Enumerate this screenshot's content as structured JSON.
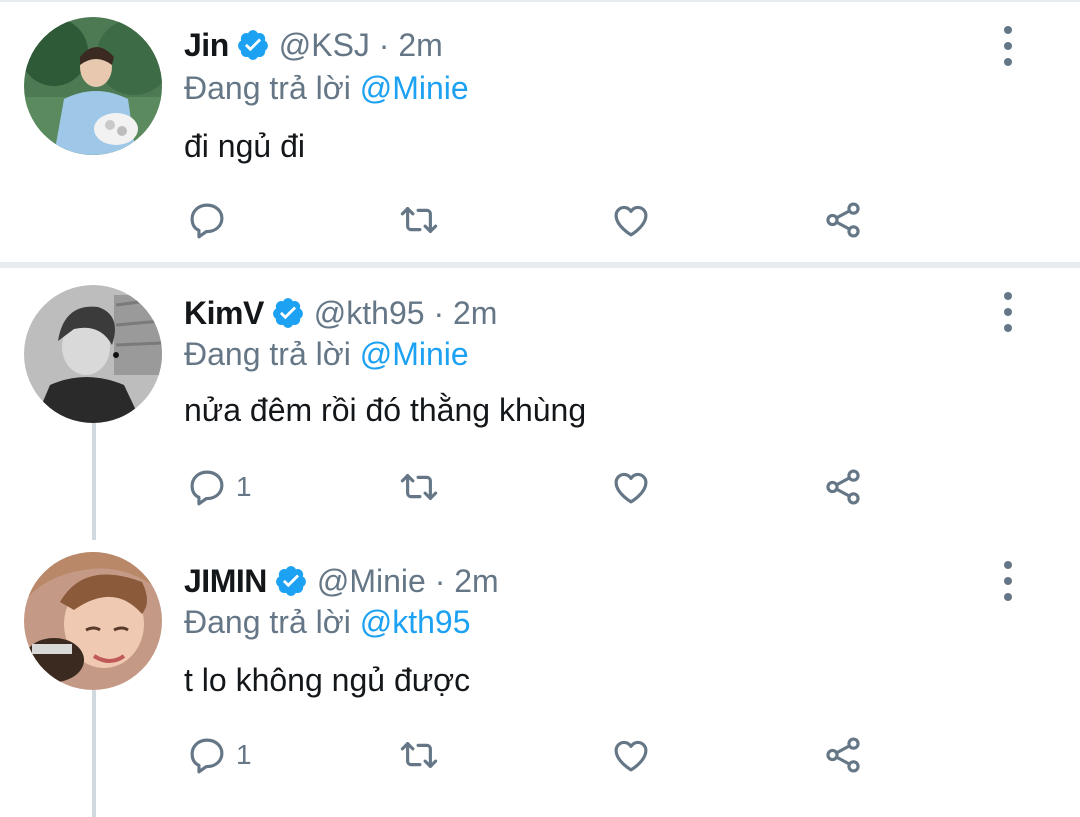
{
  "tweets": [
    {
      "name": "Jin",
      "handle": "@KSJ · 2m",
      "reply_prefix": "Đang trả lời",
      "reply_to": "@Minie",
      "text": "đi ngủ đi",
      "reply_count": ""
    },
    {
      "name": "KimV",
      "handle": "@kth95 · 2m",
      "reply_prefix": "Đang trả lời",
      "reply_to": "@Minie",
      "text": "nửa đêm rồi đó thằng khùng",
      "reply_count": "1"
    },
    {
      "name": "JIMIN",
      "handle": "@Minie · 2m",
      "reply_prefix": "Đang trả lời",
      "reply_to": "@kth95",
      "text": "t lo không ngủ được",
      "reply_count": "1"
    }
  ],
  "icons": {
    "verified": "verified-badge-icon",
    "reply": "reply-icon",
    "retweet": "retweet-icon",
    "like": "heart-icon",
    "share": "share-icon",
    "more": "more-vertical-icon"
  },
  "colors": {
    "accent": "#1da1f2",
    "secondary_text": "#657786",
    "primary_text": "#14171a",
    "divider": "#e6ecf0"
  }
}
